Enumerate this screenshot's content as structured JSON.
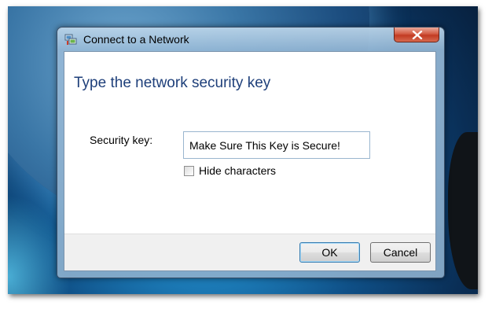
{
  "window": {
    "title": "Connect to a Network",
    "icon": "network-connection-icon",
    "close_icon": "close-icon"
  },
  "content": {
    "heading": "Type the network security key",
    "security_key_label": "Security key:",
    "security_key_value": "Make Sure This Key is Secure!",
    "hide_characters_label": "Hide characters",
    "hide_characters_checked": false
  },
  "footer": {
    "ok_label": "OK",
    "cancel_label": "Cancel"
  },
  "colors": {
    "heading": "#1e3f7a",
    "close_button": "#c23a22",
    "default_button_border": "#3c7fb1"
  }
}
